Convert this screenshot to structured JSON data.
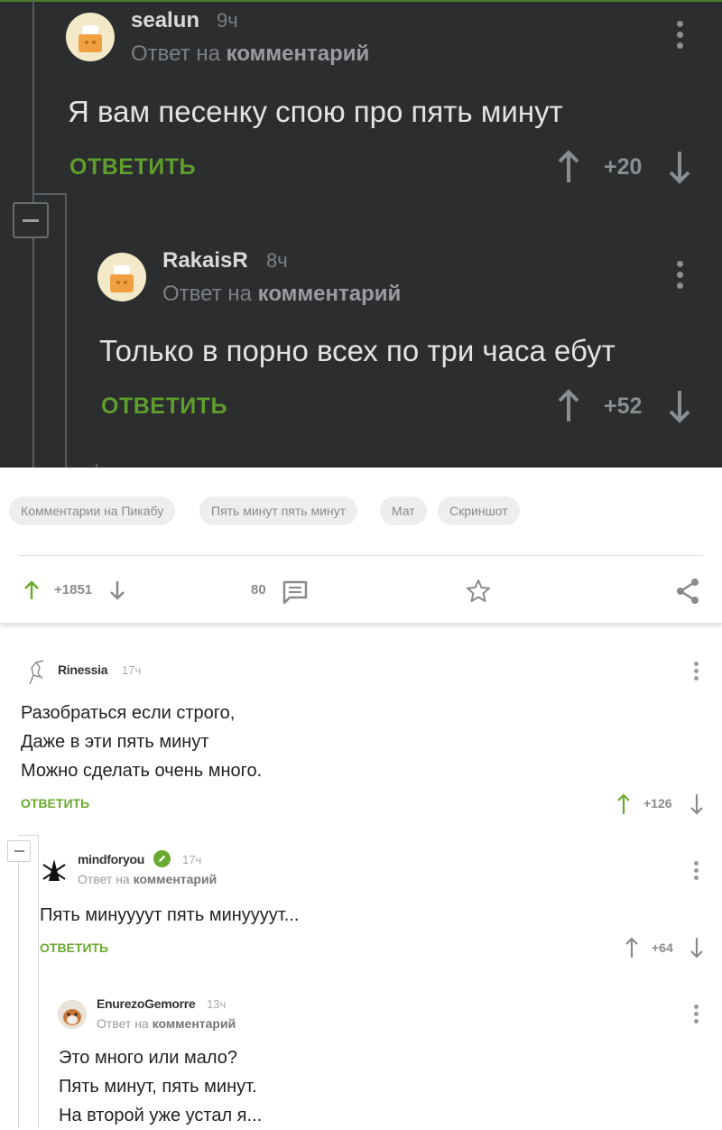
{
  "dark_section": {
    "comments": [
      {
        "author": "sealun",
        "time": "9ч",
        "reply_prefix": "Ответ на",
        "reply_target": "комментарий",
        "text": "Я вам песенку спою про пять минут",
        "reply_label": "ОТВЕТИТЬ",
        "score": "+20"
      },
      {
        "author": "RakaisR",
        "time": "8ч",
        "reply_prefix": "Ответ на",
        "reply_target": "комментарий",
        "text": "Только в порно всех по три часа ебут",
        "reply_label": "ОТВЕТИТЬ",
        "score": "+52"
      }
    ]
  },
  "post_footer": {
    "tags": [
      "Комментарии на Пикабу",
      "Пять минут пять минут",
      "Мат",
      "Скриншот"
    ],
    "rating": "+1851",
    "comments_count": "80"
  },
  "comments": [
    {
      "author": "Rinessia",
      "time": "17ч",
      "lines": [
        "Разобраться если строго,",
        "Даже в эти пять минут",
        "Можно сделать очень много."
      ],
      "reply_label": "ОТВЕТИТЬ",
      "score": "+126"
    },
    {
      "author": "mindforyou",
      "time": "17ч",
      "reply_prefix": "Ответ на",
      "reply_target": "комментарий",
      "lines": [
        "Пять минуууут пять минуууут..."
      ],
      "reply_label": "ОТВЕТИТЬ",
      "score": "+64"
    },
    {
      "author": "EnurezoGemorre",
      "time": "13ч",
      "reply_prefix": "Ответ на",
      "reply_target": "комментарий",
      "lines": [
        "Это много или мало?",
        "Пять минут, пять минут.",
        "На второй уже устал я..."
      ]
    }
  ],
  "colors": {
    "dark_bg": "#2b2d2e",
    "accent_green": "#6aaa2e",
    "dark_green": "#5e9e2c",
    "muted_text": "#8a8a8a"
  }
}
